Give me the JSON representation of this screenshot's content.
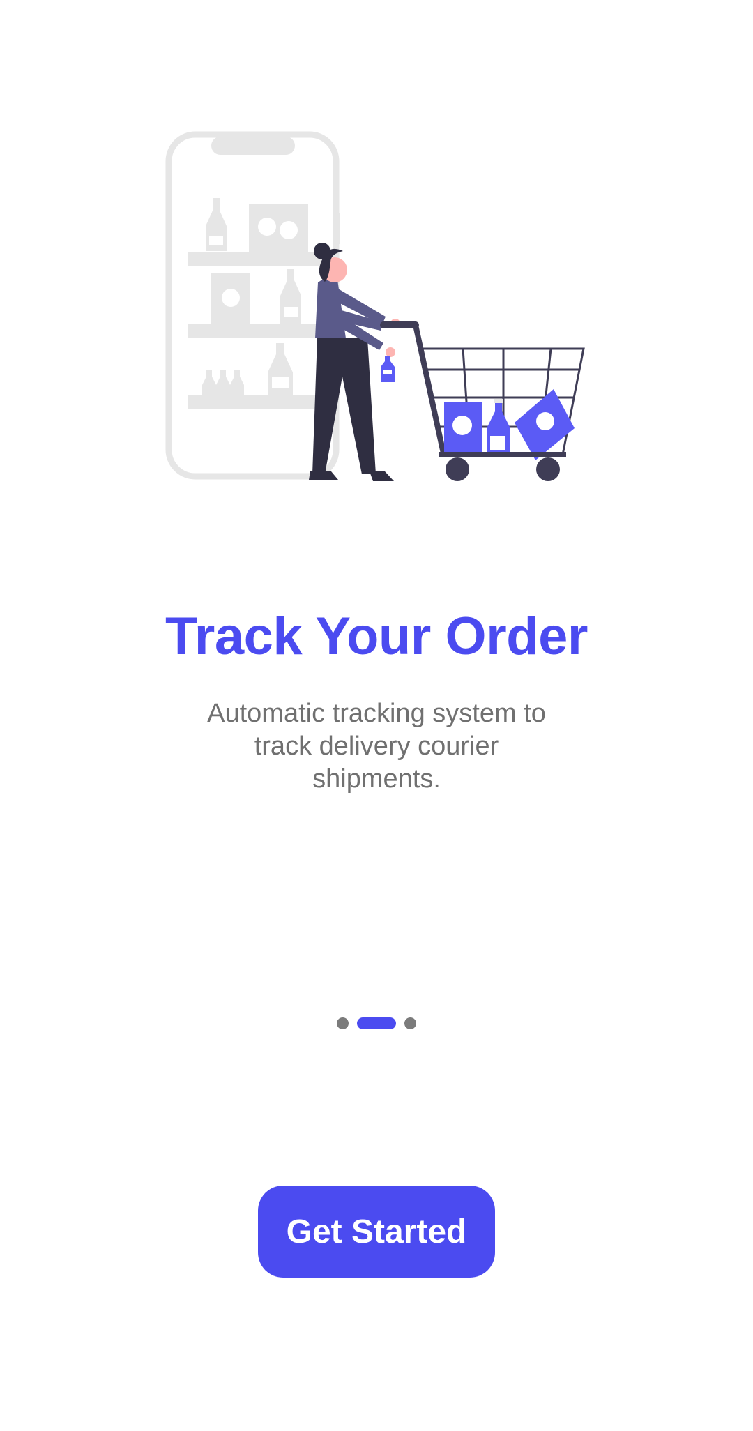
{
  "colors": {
    "accent": "#4B4BF0",
    "title": "#4B4BF0",
    "subtitle": "#707070",
    "dot_inactive": "#7B7B7B",
    "dot_active": "#4B4BF0",
    "illustration_gray": "#E6E6E6",
    "illustration_dark": "#2F2E41",
    "illustration_shirt": "#5A5A8A",
    "illustration_purple": "#5B5BF5",
    "illustration_skin": "#FDB5B2"
  },
  "hero": {
    "illustration": "shopping-cart-illustration"
  },
  "onboarding": {
    "title": "Track Your Order",
    "subtitle": "Automatic tracking system to track delivery courier shipments.",
    "page_index": 2,
    "page_count": 3
  },
  "cta": {
    "label": "Get Started"
  }
}
